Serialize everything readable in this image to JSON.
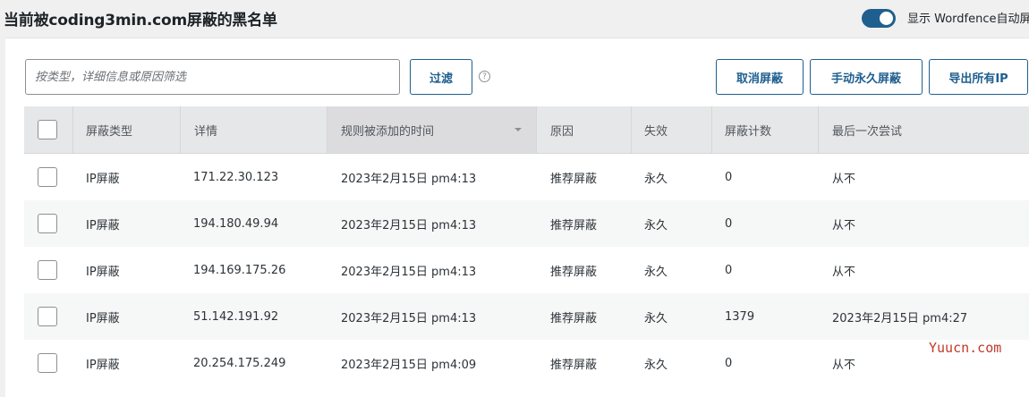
{
  "header": {
    "title": "当前被coding3min.com屏蔽的黑名单",
    "toggle_label": "显示 Wordfence自动屏",
    "toggle_on": true
  },
  "filter": {
    "placeholder": "按类型，详细信息或原因筛选",
    "filter_button": "过滤",
    "help_icon": "?"
  },
  "actions": {
    "unblock": "取消屏蔽",
    "manual_block": "手动永久屏蔽",
    "export": "导出所有IP"
  },
  "table": {
    "columns": [
      "屏蔽类型",
      "详情",
      "规则被添加的时间",
      "原因",
      "失效",
      "屏蔽计数",
      "最后一次尝试"
    ],
    "rows": [
      {
        "type": "IP屏蔽",
        "detail": "171.22.30.123",
        "added": "2023年2月15日 pm4:13",
        "reason": "推荐屏蔽",
        "expiry": "永久",
        "count": "0",
        "last": "从不"
      },
      {
        "type": "IP屏蔽",
        "detail": "194.180.49.94",
        "added": "2023年2月15日 pm4:13",
        "reason": "推荐屏蔽",
        "expiry": "永久",
        "count": "0",
        "last": "从不"
      },
      {
        "type": "IP屏蔽",
        "detail": "194.169.175.26",
        "added": "2023年2月15日 pm4:13",
        "reason": "推荐屏蔽",
        "expiry": "永久",
        "count": "0",
        "last": "从不"
      },
      {
        "type": "IP屏蔽",
        "detail": "51.142.191.92",
        "added": "2023年2月15日 pm4:13",
        "reason": "推荐屏蔽",
        "expiry": "永久",
        "count": "1379",
        "last": "2023年2月15日 pm4:27"
      },
      {
        "type": "IP屏蔽",
        "detail": "20.254.175.249",
        "added": "2023年2月15日 pm4:09",
        "reason": "推荐屏蔽",
        "expiry": "永久",
        "count": "0",
        "last": "从不"
      }
    ]
  },
  "watermark": "Yuucn.com",
  "colors": {
    "accent": "#1f5f8f",
    "watermark": "#c0392b"
  }
}
